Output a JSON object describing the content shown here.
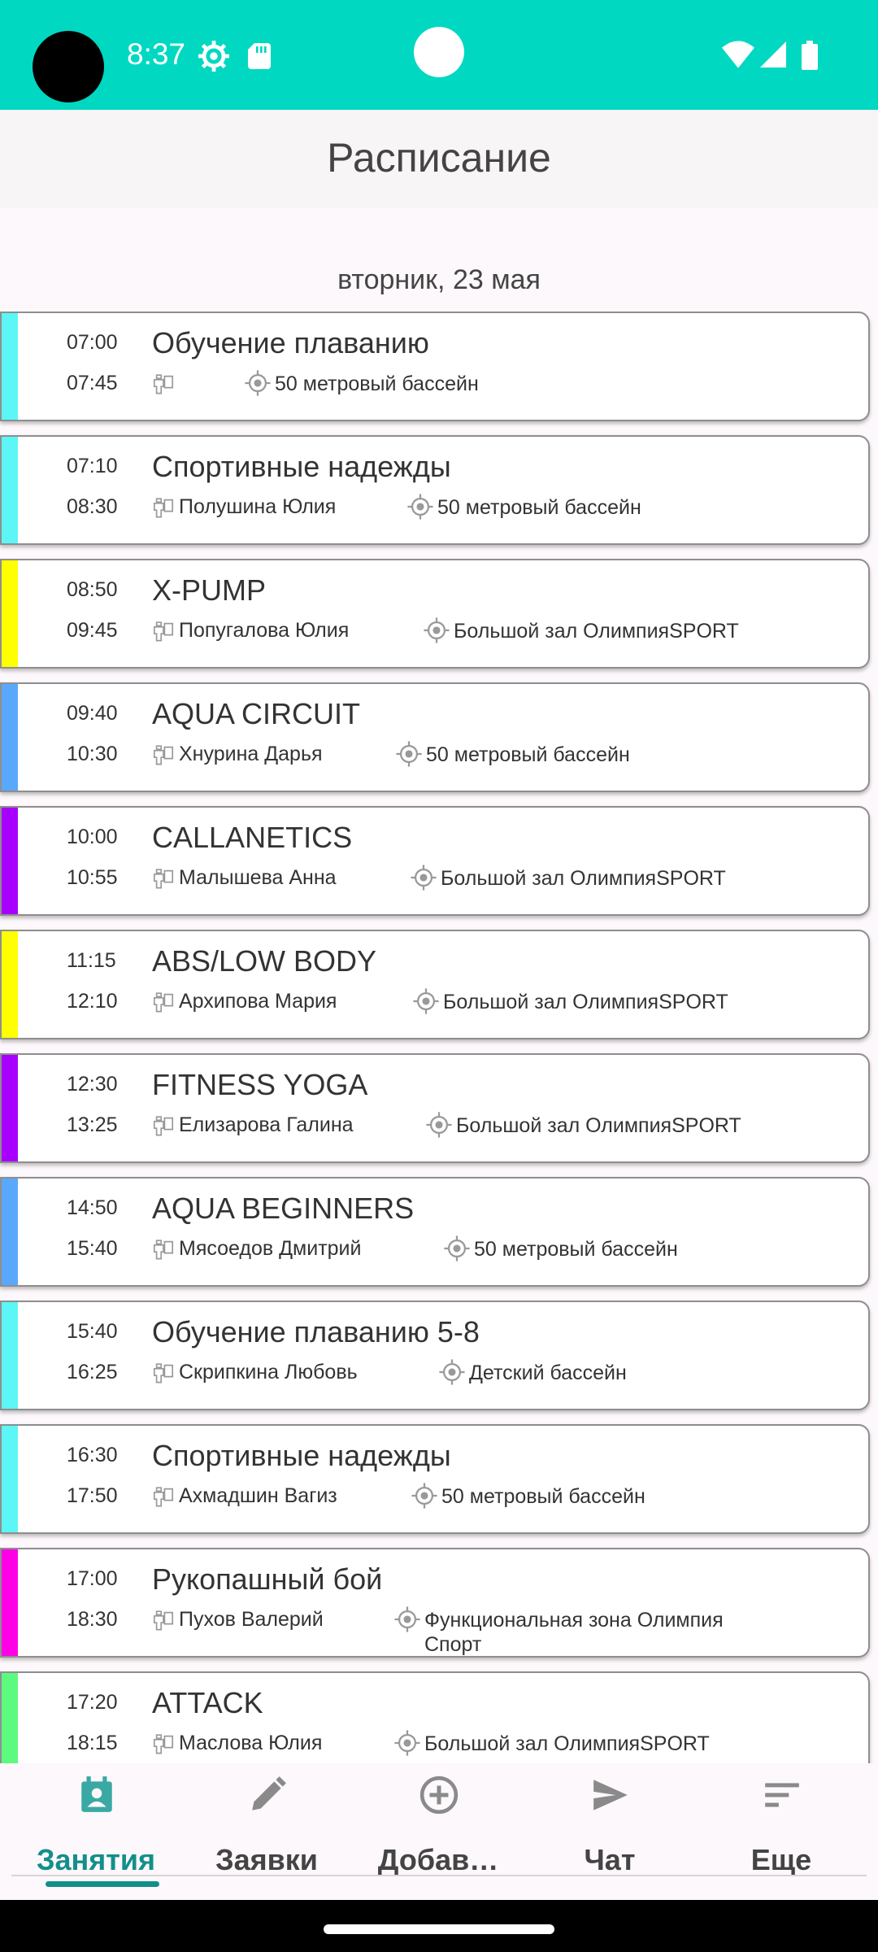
{
  "status_bar": {
    "time": "8:37"
  },
  "header": {
    "title": "Расписание"
  },
  "date_heading": "вторник, 23 мая",
  "classes": [
    {
      "start": "07:00",
      "end": "07:45",
      "name": "Обучение плаванию",
      "trainer": "",
      "place": "50 метровый бассейн",
      "color": "#5cf6f6"
    },
    {
      "start": "07:10",
      "end": "08:30",
      "name": "Спортивные надежды",
      "trainer": "Полушина Юлия",
      "place": "50 метровый бассейн",
      "color": "#5cf6f6"
    },
    {
      "start": "08:50",
      "end": "09:45",
      "name": "X-PUMP",
      "trainer": "Попугалова Юлия",
      "place": "Большой зал ОлимпияSPORT",
      "color": "#ffff00"
    },
    {
      "start": "09:40",
      "end": "10:30",
      "name": "AQUA CIRCUIT",
      "trainer": "Хнурина Дарья",
      "place": "50 метровый бассейн",
      "color": "#5aa8fb"
    },
    {
      "start": "10:00",
      "end": "10:55",
      "name": "CALLANETICS",
      "trainer": "Малышева Анна",
      "place": "Большой зал ОлимпияSPORT",
      "color": "#a800ff"
    },
    {
      "start": "11:15",
      "end": "12:10",
      "name": "ABS/LOW BODY",
      "trainer": "Архипова Мария",
      "place": "Большой зал ОлимпияSPORT",
      "color": "#ffff00"
    },
    {
      "start": "12:30",
      "end": "13:25",
      "name": "FITNESS YOGA",
      "trainer": "Елизарова Галина",
      "place": "Большой зал ОлимпияSPORT",
      "color": "#a800ff"
    },
    {
      "start": "14:50",
      "end": "15:40",
      "name": "AQUA BEGINNERS",
      "trainer": "Мясоедов Дмитрий",
      "place": "50 метровый бассейн",
      "color": "#5aa8fb"
    },
    {
      "start": "15:40",
      "end": "16:25",
      "name": "Обучение плаванию 5-8",
      "trainer": "Скрипкина Любовь",
      "place": "Детский бассейн",
      "color": "#5cf6f6"
    },
    {
      "start": "16:30",
      "end": "17:50",
      "name": "Спортивные надежды",
      "trainer": "Ахмадшин Вагиз",
      "place": "50 метровый бассейн",
      "color": "#5cf6f6"
    },
    {
      "start": "17:00",
      "end": "18:30",
      "name": "Рукопашный бой",
      "trainer": "Пухов Валерий",
      "place": "Функциональная зона Олимпия Спорт",
      "color": "#ff00e6"
    },
    {
      "start": "17:20",
      "end": "18:15",
      "name": " ATTACK",
      "trainer": "Маслова Юлия",
      "place": "Большой зал ОлимпияSPORT",
      "color": "#5cfb80"
    }
  ],
  "nav": [
    {
      "label": "Занятия",
      "icon": "calendar-person-icon",
      "active": true
    },
    {
      "label": "Заявки",
      "icon": "pencil-icon",
      "active": false
    },
    {
      "label": "Добав…",
      "icon": "add-circle-icon",
      "active": false
    },
    {
      "label": "Чат",
      "icon": "send-icon",
      "active": false
    },
    {
      "label": "Еще",
      "icon": "sort-icon",
      "active": false
    }
  ],
  "colors": {
    "status_bar": "#00d8c2",
    "accent": "#138f8a"
  }
}
